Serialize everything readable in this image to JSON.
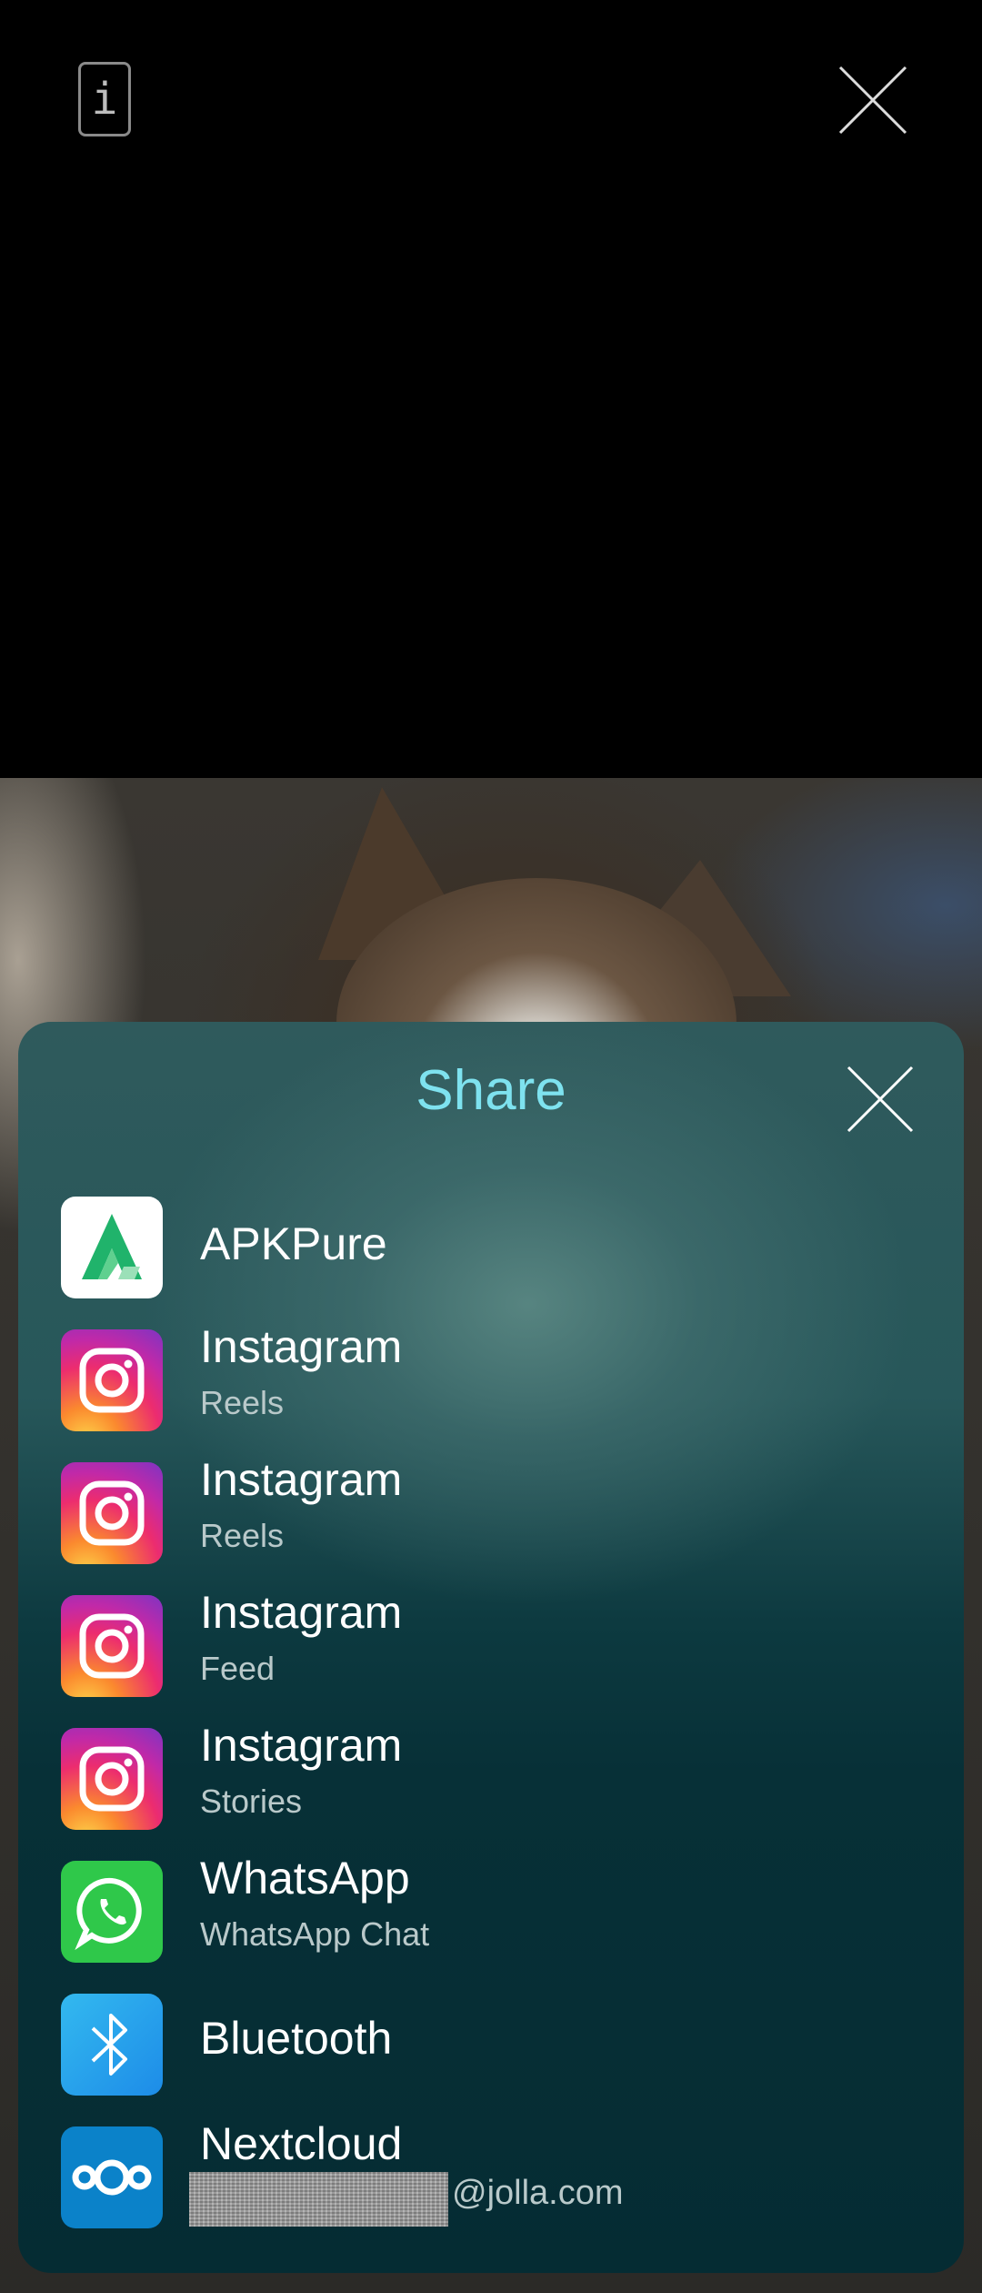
{
  "header": {
    "info_icon": "info-icon",
    "close_icon": "close-icon"
  },
  "share_sheet": {
    "title": "Share",
    "close_icon": "close-icon",
    "items": [
      {
        "title": "APKPure",
        "subtitle": "",
        "icon": "apkpure-icon"
      },
      {
        "title": "Instagram",
        "subtitle": "Reels",
        "icon": "instagram-icon"
      },
      {
        "title": "Instagram",
        "subtitle": "Reels",
        "icon": "instagram-icon"
      },
      {
        "title": "Instagram",
        "subtitle": "Feed",
        "icon": "instagram-icon"
      },
      {
        "title": "Instagram",
        "subtitle": "Stories",
        "icon": "instagram-icon"
      },
      {
        "title": "WhatsApp",
        "subtitle": "WhatsApp Chat",
        "icon": "whatsapp-icon"
      },
      {
        "title": "Bluetooth",
        "subtitle": "",
        "icon": "bluetooth-icon"
      },
      {
        "title": "Nextcloud",
        "subtitle": "@jolla.com",
        "icon": "nextcloud-icon"
      }
    ]
  },
  "colors": {
    "title_accent": "#7ee2ef",
    "sheet_bg": "#052c33"
  }
}
